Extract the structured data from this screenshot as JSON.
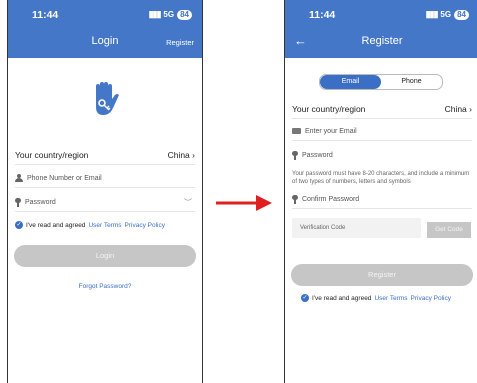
{
  "login": {
    "status_time": "11:44",
    "network": "5G",
    "battery": "84",
    "title": "Login",
    "register_link": "Register",
    "country_label": "Your country/region",
    "country_value": "China",
    "phone_placeholder": "Phone Number or Email",
    "password_placeholder": "Password",
    "agree_text": "I've read and agreed",
    "user_terms": "User Terms",
    "privacy_policy": "Privacy Policy",
    "login_button": "Login",
    "forgot": "Forgot Password?"
  },
  "register": {
    "status_time": "11:44",
    "network": "5G",
    "battery": "84",
    "title": "Register",
    "tab_email": "Email",
    "tab_phone": "Phone",
    "country_label": "Your country/region",
    "country_value": "China",
    "email_placeholder": "Enter your Email",
    "password_placeholder": "Password",
    "password_hint": "Your password must have 8-20 characters, and include a minimum of two types of numbers, letters and symbols",
    "confirm_placeholder": "Confirm Password",
    "verification_placeholder": "Verification Code",
    "get_code": "Get Code",
    "register_button": "Register",
    "agree_text": "I've read and agreed",
    "user_terms": "User Terms",
    "privacy_policy": "Privacy Policy"
  },
  "icons": {
    "arrow": "red-arrow-right",
    "hand": "hand-key-logo"
  },
  "colors": {
    "header": "#4577c9",
    "link": "#3b6fc6",
    "arrow": "#e02020",
    "disabled_button": "#c6c6c6"
  }
}
